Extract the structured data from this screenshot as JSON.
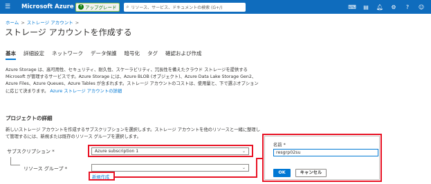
{
  "topbar": {
    "menu_icon": "hamburger-icon",
    "brand": "Microsoft Azure",
    "upgrade_label": "アップグレード",
    "search_placeholder": "リソース、サービス、ドキュメントの検索 (G+/)",
    "icons": [
      "cloud-shell-icon",
      "directory-icon",
      "notifications-icon",
      "settings-icon",
      "help-icon",
      "feedback-icon"
    ]
  },
  "breadcrumb": [
    "ホーム",
    "ストレージ アカウント"
  ],
  "page": {
    "title": "ストレージ アカウントを作成する",
    "more": "…"
  },
  "tabs": [
    {
      "label": "基本",
      "active": true
    },
    {
      "label": "詳細設定",
      "active": false
    },
    {
      "label": "ネットワーク",
      "active": false
    },
    {
      "label": "データ保護",
      "active": false
    },
    {
      "label": "暗号化",
      "active": false
    },
    {
      "label": "タグ",
      "active": false
    },
    {
      "label": "確認および作成",
      "active": false
    }
  ],
  "description": {
    "text": "Azure Storage は、高可用性、セキュリティ、耐久性、スケーラビリティ、冗長性を備えたクラウド ストレージを提供する Microsoft が管理するサービスです。Azure Storage には、Azure BLOB (オブジェクト)、Azure Data Lake Storage Gen2、Azure Files、Azure Queues、Azure Tables が含まれます。ストレージ アカウントのコストは、使用量と、下で選ぶオプションに応じて決まります。",
    "link": "Azure ストレージ アカウントの詳細"
  },
  "project": {
    "title": "プロジェクトの詳細",
    "desc": "新しいストレージ アカウントを作成するサブスクリプションを選択します。ストレージ アカウントを他のリソースと一緒に整理して管理するには、新規または既存のリソース グループを選択します。",
    "subscription_label": "サブスクリプション *",
    "subscription_value": "Azure subscription 1",
    "resource_group_label": "リソース グループ *",
    "resource_group_value": "",
    "new_link": "新規作成"
  },
  "popup": {
    "name_label": "名前 *",
    "name_value": "resgrp02su",
    "ok_label": "OK",
    "cancel_label": "キャンセル"
  },
  "colors": {
    "topbar": "#0f6cbd",
    "accent": "#0078d4",
    "highlight": "#e81123"
  }
}
